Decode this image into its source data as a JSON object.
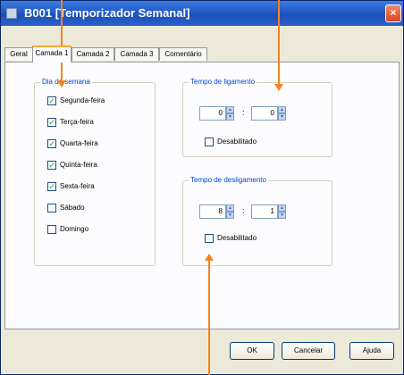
{
  "window": {
    "title": "B001 [Temporizador Semanal]",
    "close_glyph": "×"
  },
  "tabs": [
    {
      "label": "Geral"
    },
    {
      "label": "Camada 1",
      "active": true
    },
    {
      "label": "Camada 2"
    },
    {
      "label": "Camada 3"
    },
    {
      "label": "Comentário"
    }
  ],
  "days_group": {
    "title": "Dia da semana",
    "days": [
      {
        "label": "Segunda-feira",
        "checked": true
      },
      {
        "label": "Terça-feira",
        "checked": true
      },
      {
        "label": "Quarta-feira",
        "checked": true
      },
      {
        "label": "Quinta-feira",
        "checked": true
      },
      {
        "label": "Sexta-feira",
        "checked": true
      },
      {
        "label": "Sábado",
        "checked": false
      },
      {
        "label": "Domingo",
        "checked": false
      }
    ]
  },
  "on_time": {
    "title": "Tempo de ligamento",
    "hours": "0",
    "minutes": "0",
    "separator": ":",
    "disabled_label": "Desabilitado",
    "disabled_checked": false
  },
  "off_time": {
    "title": "Tempo de desligamento",
    "hours": "8",
    "minutes": "1",
    "separator": ":",
    "disabled_label": "Desabilitado",
    "disabled_checked": false
  },
  "buttons": {
    "ok": "OK",
    "cancel": "Cancelar",
    "help": "Ajuda"
  },
  "check_glyph": "✓",
  "colors": {
    "annotation_arrow": "#f58220",
    "title_bar": "#2259c8",
    "group_title": "#0046d5"
  }
}
